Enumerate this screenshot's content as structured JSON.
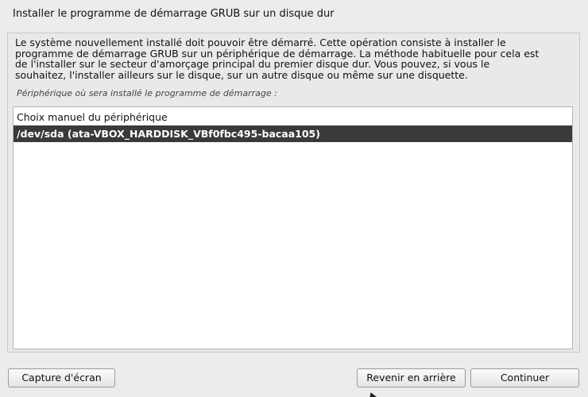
{
  "window": {
    "title": "Installer le programme de démarrage GRUB sur un disque dur"
  },
  "panel": {
    "description": "Le système nouvellement installé doit pouvoir être démarré. Cette opération consiste à installer le\nprogramme de démarrage GRUB sur un périphérique de démarrage. La méthode habituelle pour cela est\nde l'installer sur le secteur d'amorçage principal du premier disque dur. Vous pouvez, si vous le\nsouhaitez, l'installer ailleurs sur le disque, sur un autre disque ou même sur une disquette.",
    "prompt": "Périphérique où sera installé le programme de démarrage :"
  },
  "device_list": {
    "items": [
      {
        "label": "Choix manuel du périphérique",
        "selected": false
      },
      {
        "label": "/dev/sda  (ata-VBOX_HARDDISK_VBf0fbc495-bacaa105)",
        "selected": true
      }
    ]
  },
  "buttons": {
    "screenshot": "Capture d'écran",
    "back": "Revenir en arrière",
    "continue": "Continuer"
  }
}
